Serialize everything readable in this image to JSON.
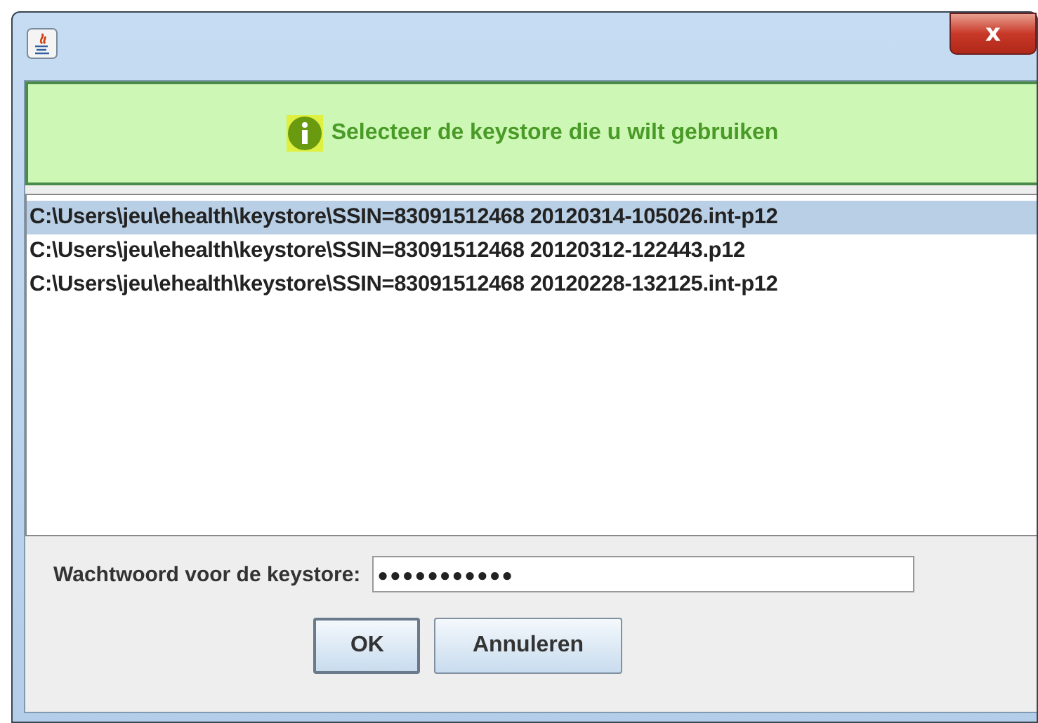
{
  "window": {
    "close_symbol": "x"
  },
  "banner": {
    "message": "Selecteer de keystore die u wilt gebruiken"
  },
  "keystores": [
    {
      "path": "C:\\Users\\jeu\\ehealth\\keystore\\SSIN=83091512468 20120314-105026.int-p12",
      "selected": true
    },
    {
      "path": "C:\\Users\\jeu\\ehealth\\keystore\\SSIN=83091512468 20120312-122443.p12",
      "selected": false
    },
    {
      "path": "C:\\Users\\jeu\\ehealth\\keystore\\SSIN=83091512468 20120228-132125.int-p12",
      "selected": false
    }
  ],
  "password": {
    "label": "Wachtwoord voor de keystore:",
    "value": "●●●●●●●●●●●"
  },
  "buttons": [
    {
      "label": "OK",
      "focused": true
    },
    {
      "label": "Annuleren",
      "focused": false
    }
  ]
}
